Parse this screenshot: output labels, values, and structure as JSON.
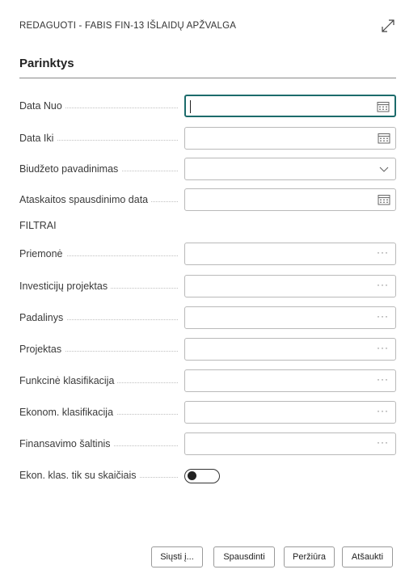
{
  "dialog": {
    "title": "REDAGUOTI - FABIS FIN-13 IŠLAIDŲ APŽVALGA"
  },
  "section": {
    "title": "Parinktys",
    "filters_label": "FILTRAI"
  },
  "fields": {
    "data_nuo": {
      "label": "Data Nuo",
      "value": ""
    },
    "data_iki": {
      "label": "Data Iki",
      "value": ""
    },
    "biudzeto": {
      "label": "Biudžeto pavadinimas",
      "value": ""
    },
    "spausdinimo": {
      "label": "Ataskaitos spausdinimo data",
      "value": ""
    },
    "priemone": {
      "label": "Priemonė",
      "value": ""
    },
    "investiciju": {
      "label": "Investicijų projektas",
      "value": ""
    },
    "padalinys": {
      "label": "Padalinys",
      "value": ""
    },
    "projektas": {
      "label": "Projektas",
      "value": ""
    },
    "funkcine": {
      "label": "Funkcinė klasifikacija",
      "value": ""
    },
    "ekonom": {
      "label": "Ekonom. klasifikacija",
      "value": ""
    },
    "finansavimo": {
      "label": "Finansavimo šaltinis",
      "value": ""
    },
    "ekon_klas_toggle": {
      "label": "Ekon. klas. tik su skaičiais",
      "on": false
    }
  },
  "icons": {
    "expand": "expand-icon",
    "calendar": "calendar-icon",
    "dropdown": "chevron-down-icon",
    "lookup": "ellipsis-icon"
  },
  "buttons": {
    "send": "Siųsti į...",
    "print": "Spausdinti",
    "preview": "Peržiūra",
    "cancel": "Atšaukti"
  },
  "colors": {
    "focus": "#1c6b6b"
  }
}
